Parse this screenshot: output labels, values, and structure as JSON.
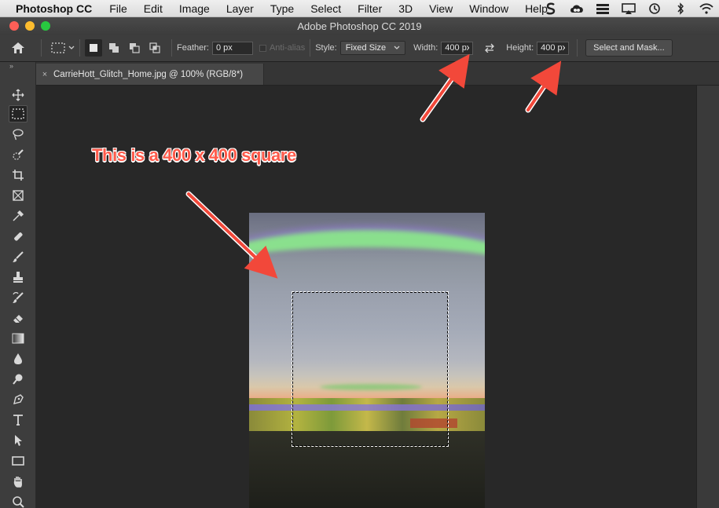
{
  "menubar": {
    "app_name": "Photoshop CC",
    "items": [
      "File",
      "Edit",
      "Image",
      "Layer",
      "Type",
      "Select",
      "Filter",
      "3D",
      "View",
      "Window",
      "Help"
    ],
    "status_icons": [
      "s-icon",
      "creative-cloud-icon",
      "stack-icon",
      "airplay-icon",
      "time-machine-icon",
      "bluetooth-icon",
      "wifi-icon"
    ]
  },
  "titlebar": {
    "title": "Adobe Photoshop CC 2019"
  },
  "options": {
    "feather_label": "Feather:",
    "feather_value": "0 px",
    "antialias_label": "Anti-alias",
    "style_label": "Style:",
    "style_value": "Fixed Size",
    "width_label": "Width:",
    "width_value": "400 px",
    "height_label": "Height:",
    "height_value": "400 px",
    "select_mask_label": "Select and Mask..."
  },
  "document": {
    "tab_title": "CarrieHott_Glitch_Home.jpg @ 100% (RGB/8*)",
    "close_glyph": "×"
  },
  "annotation": {
    "text": "This is a 400 x 400 square",
    "color": "#ff5a4a"
  },
  "toolbar": {
    "expand_glyph": "»",
    "tools": [
      "move-tool",
      "rectangular-marquee-tool",
      "lasso-tool",
      "quick-selection-tool",
      "crop-tool",
      "frame-tool",
      "eyedropper-tool",
      "healing-brush-tool",
      "brush-tool",
      "clone-stamp-tool",
      "history-brush-tool",
      "eraser-tool",
      "gradient-tool",
      "blur-tool",
      "dodge-tool",
      "pen-tool",
      "type-tool",
      "path-selection-tool",
      "rectangle-tool",
      "hand-tool",
      "zoom-tool"
    ],
    "active_tool": "rectangular-marquee-tool"
  }
}
